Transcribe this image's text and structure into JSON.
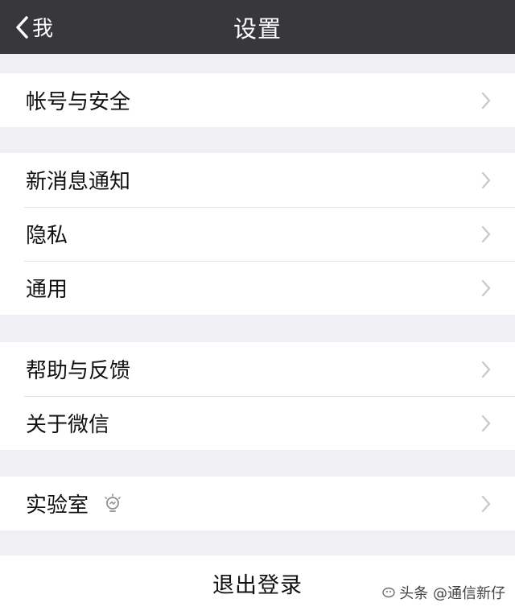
{
  "nav": {
    "back_label": "我",
    "title": "设置"
  },
  "groups": [
    {
      "items": [
        {
          "label": "帐号与安全"
        }
      ]
    },
    {
      "items": [
        {
          "label": "新消息通知"
        },
        {
          "label": "隐私"
        },
        {
          "label": "通用"
        }
      ]
    },
    {
      "items": [
        {
          "label": "帮助与反馈"
        },
        {
          "label": "关于微信"
        }
      ]
    },
    {
      "items": [
        {
          "label": "实验室"
        }
      ]
    }
  ],
  "logout": {
    "label": "退出登录"
  },
  "watermark": {
    "text": "头条 @通信新仔"
  },
  "colors": {
    "nav_bg": "#38383c",
    "page_bg": "#efeff4",
    "cell_bg": "#ffffff",
    "chevron": "#c7c7cc"
  }
}
